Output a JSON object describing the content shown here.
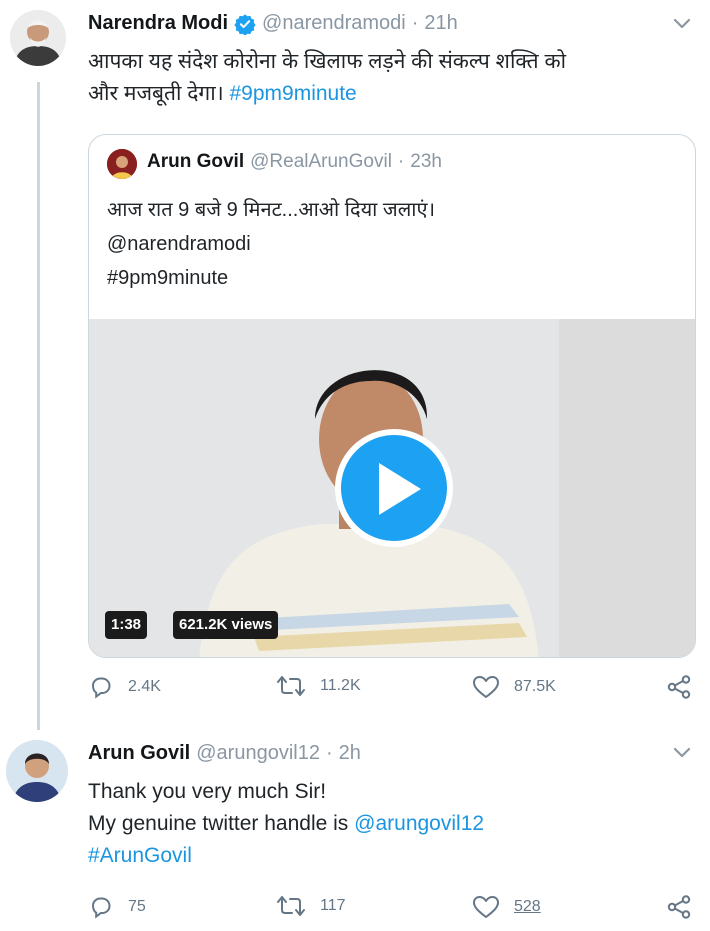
{
  "tweet1": {
    "name": "Narendra Modi",
    "handle": "@narendramodi",
    "time": "21h",
    "text_line1": "आपका यह संदेश कोरोना के खिलाफ लड़ने की संकल्प शक्ति को",
    "text_line2": "और मजबूती देगा।",
    "hashtag": "#9pm9minute",
    "quoted": {
      "name": "Arun Govil",
      "handle": "@RealArunGovil",
      "time": "23h",
      "line1": "आज रात 9 बजे 9 मिनट...आओ दिया जलाएं।",
      "line2": "@narendramodi",
      "line3": "#9pm9minute",
      "video_duration": "1:38",
      "video_views": "621.2K views"
    },
    "replies": "2.4K",
    "retweets": "11.2K",
    "likes": "87.5K"
  },
  "tweet2": {
    "name": "Arun Govil",
    "handle": "@arungovil12",
    "time": "2h",
    "line1": "Thank you very much Sir!",
    "line2_prefix": "My genuine twitter handle is",
    "line2_mention": "@arungovil12",
    "hashtag": "#ArunGovil",
    "replies": "75",
    "retweets": "117",
    "likes": "528"
  },
  "colors": {
    "accent": "#1da1f2",
    "link": "#1b95e0",
    "muted": "#8a97a3"
  },
  "icons": [
    "verified-icon",
    "chevron-down-icon",
    "reply-icon",
    "retweet-icon",
    "like-icon",
    "share-icon",
    "play-icon"
  ]
}
